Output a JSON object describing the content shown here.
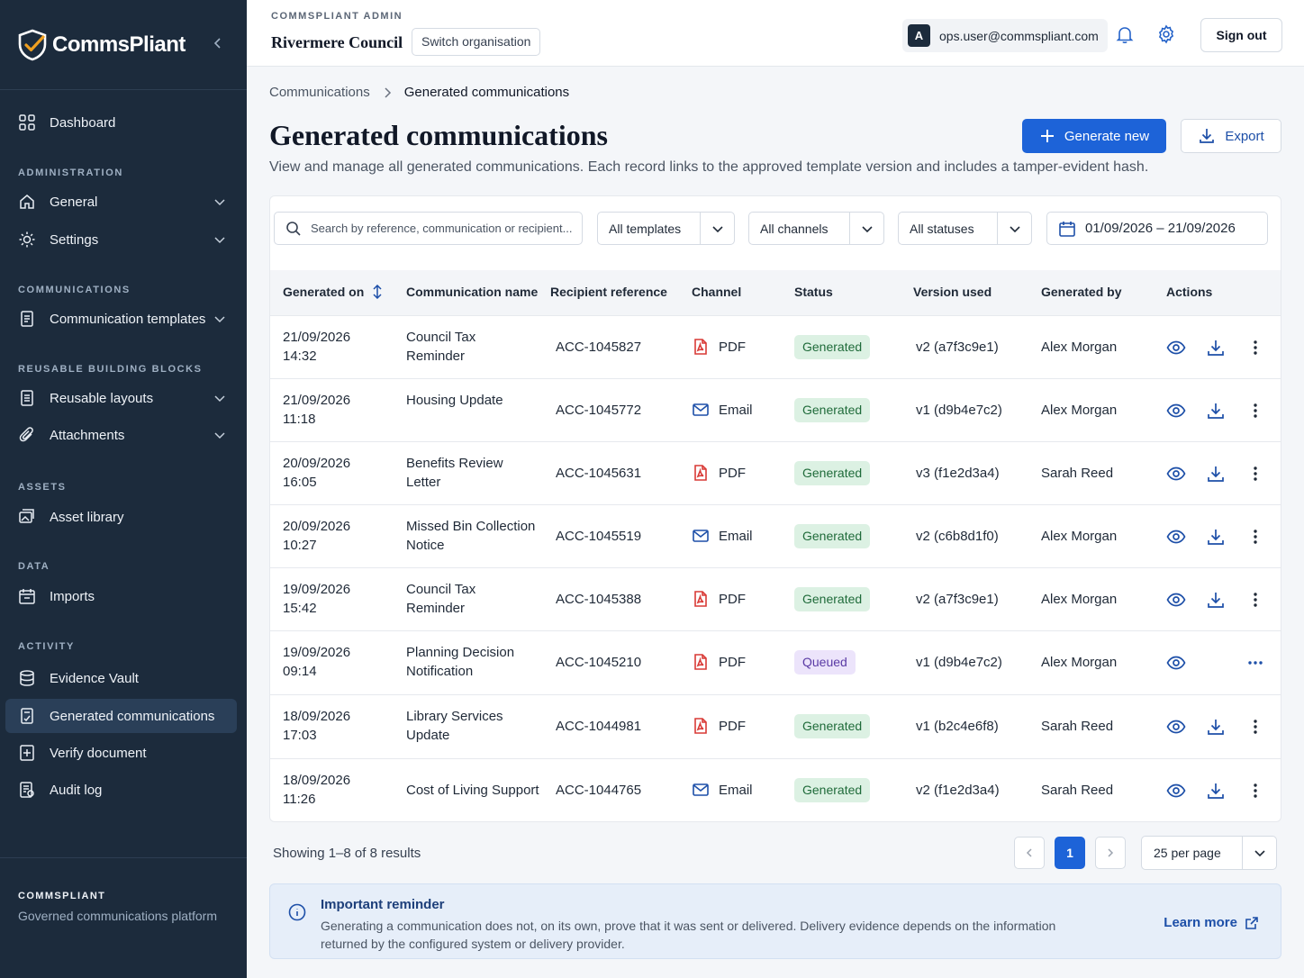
{
  "app": {
    "brand": "CommsPliant"
  },
  "sidebar": {
    "dashboard": "Dashboard",
    "sections": {
      "administration": "ADMINISTRATION",
      "communications": "COMMUNICATIONS",
      "building_blocks": "REUSABLE BUILDING BLOCKS",
      "assets": "ASSETS",
      "data": "DATA",
      "activity": "ACTIVITY"
    },
    "items": {
      "general": "General",
      "settings": "Settings",
      "templates": "Communication templates",
      "layouts": "Reusable layouts",
      "attachments": "Attachments",
      "asset_library": "Asset library",
      "imports": "Imports",
      "evidence_vault": "Evidence Vault",
      "generated": "Generated communications",
      "verify": "Verify document",
      "audit": "Audit log"
    },
    "footer": {
      "title": "COMMSPLIANT",
      "subtitle": "Governed communications platform"
    }
  },
  "topbar": {
    "org_label": "COMMSPLIANT ADMIN",
    "org_name": "Rivermere Council",
    "switch_label": "Switch organisation",
    "avatar": "A",
    "user_email": "ops.user@commspliant.com",
    "sign_out": "Sign out"
  },
  "breadcrumb": {
    "parent": "Communications",
    "current": "Generated communications"
  },
  "page": {
    "title": "Generated communications",
    "description": "View and manage all generated communications. Each record links to the approved template version and includes a tamper-evident hash.",
    "generate_label": "Generate new",
    "export_label": "Export"
  },
  "filters": {
    "search_placeholder": "Search by reference, communication or recipient...",
    "templates": "All templates",
    "channels": "All channels",
    "statuses": "All statuses",
    "date_range": "01/09/2026 – 21/09/2026"
  },
  "table": {
    "headers": {
      "generated_on": "Generated on",
      "name": "Communication name",
      "recipient": "Recipient reference",
      "channel": "Channel",
      "status": "Status",
      "version": "Version used",
      "by": "Generated by",
      "actions": "Actions"
    },
    "rows": [
      {
        "date": "21/09/2026",
        "time": "14:32",
        "name1": "Council Tax",
        "name2": "Reminder",
        "ref": "ACC-1045827",
        "channel": "PDF",
        "status": "Generated",
        "version": "v2 (a7f3c9e1)",
        "by": "Alex Morgan"
      },
      {
        "date": "21/09/2026",
        "time": "11:18",
        "name1": "Housing Update",
        "name2": "",
        "ref": "ACC-1045772",
        "channel": "Email",
        "status": "Generated",
        "version": "v1 (d9b4e7c2)",
        "by": "Alex Morgan"
      },
      {
        "date": "20/09/2026",
        "time": "16:05",
        "name1": "Benefits Review",
        "name2": "Letter",
        "ref": "ACC-1045631",
        "channel": "PDF",
        "status": "Generated",
        "version": "v3 (f1e2d3a4)",
        "by": "Sarah Reed"
      },
      {
        "date": "20/09/2026",
        "time": "10:27",
        "name1": "Missed Bin Collection",
        "name2": "Notice",
        "ref": "ACC-1045519",
        "channel": "Email",
        "status": "Generated",
        "version": "v2 (c6b8d1f0)",
        "by": "Alex Morgan"
      },
      {
        "date": "19/09/2026",
        "time": "15:42",
        "name1": "Council Tax",
        "name2": "Reminder",
        "ref": "ACC-1045388",
        "channel": "PDF",
        "status": "Generated",
        "version": "v2 (a7f3c9e1)",
        "by": "Alex Morgan"
      },
      {
        "date": "19/09/2026",
        "time": "09:14",
        "name1": "Planning Decision",
        "name2": "Notification",
        "ref": "ACC-1045210",
        "channel": "PDF",
        "status": "Queued",
        "version": "v1 (d9b4e7c2)",
        "by": "Alex Morgan"
      },
      {
        "date": "18/09/2026",
        "time": "17:03",
        "name1": "Library Services",
        "name2": "Update",
        "ref": "ACC-1044981",
        "channel": "PDF",
        "status": "Generated",
        "version": "v1 (b2c4e6f8)",
        "by": "Sarah Reed"
      },
      {
        "date": "18/09/2026",
        "time": "11:26",
        "name1": "Cost of Living Support",
        "name2": "",
        "ref": "ACC-1044765",
        "channel": "Email",
        "status": "Generated",
        "version": "v2 (f1e2d3a4)",
        "by": "Sarah Reed"
      }
    ]
  },
  "pagination": {
    "summary": "Showing 1–8 of 8 results",
    "page": "1",
    "per_page": "25 per page"
  },
  "reminder": {
    "title": "Important reminder",
    "text": "Generating a communication does not, on its own, prove that it was sent or delivered. Delivery evidence depends on the information returned by the configured system or delivery provider.",
    "link": "Learn more"
  },
  "colors": {
    "sidebar": "#1c2b3c",
    "primary": "#1d63d8",
    "pdf": "#d93a36",
    "generated_bg": "#dcf1e3",
    "queued_bg": "#ece4fb"
  }
}
